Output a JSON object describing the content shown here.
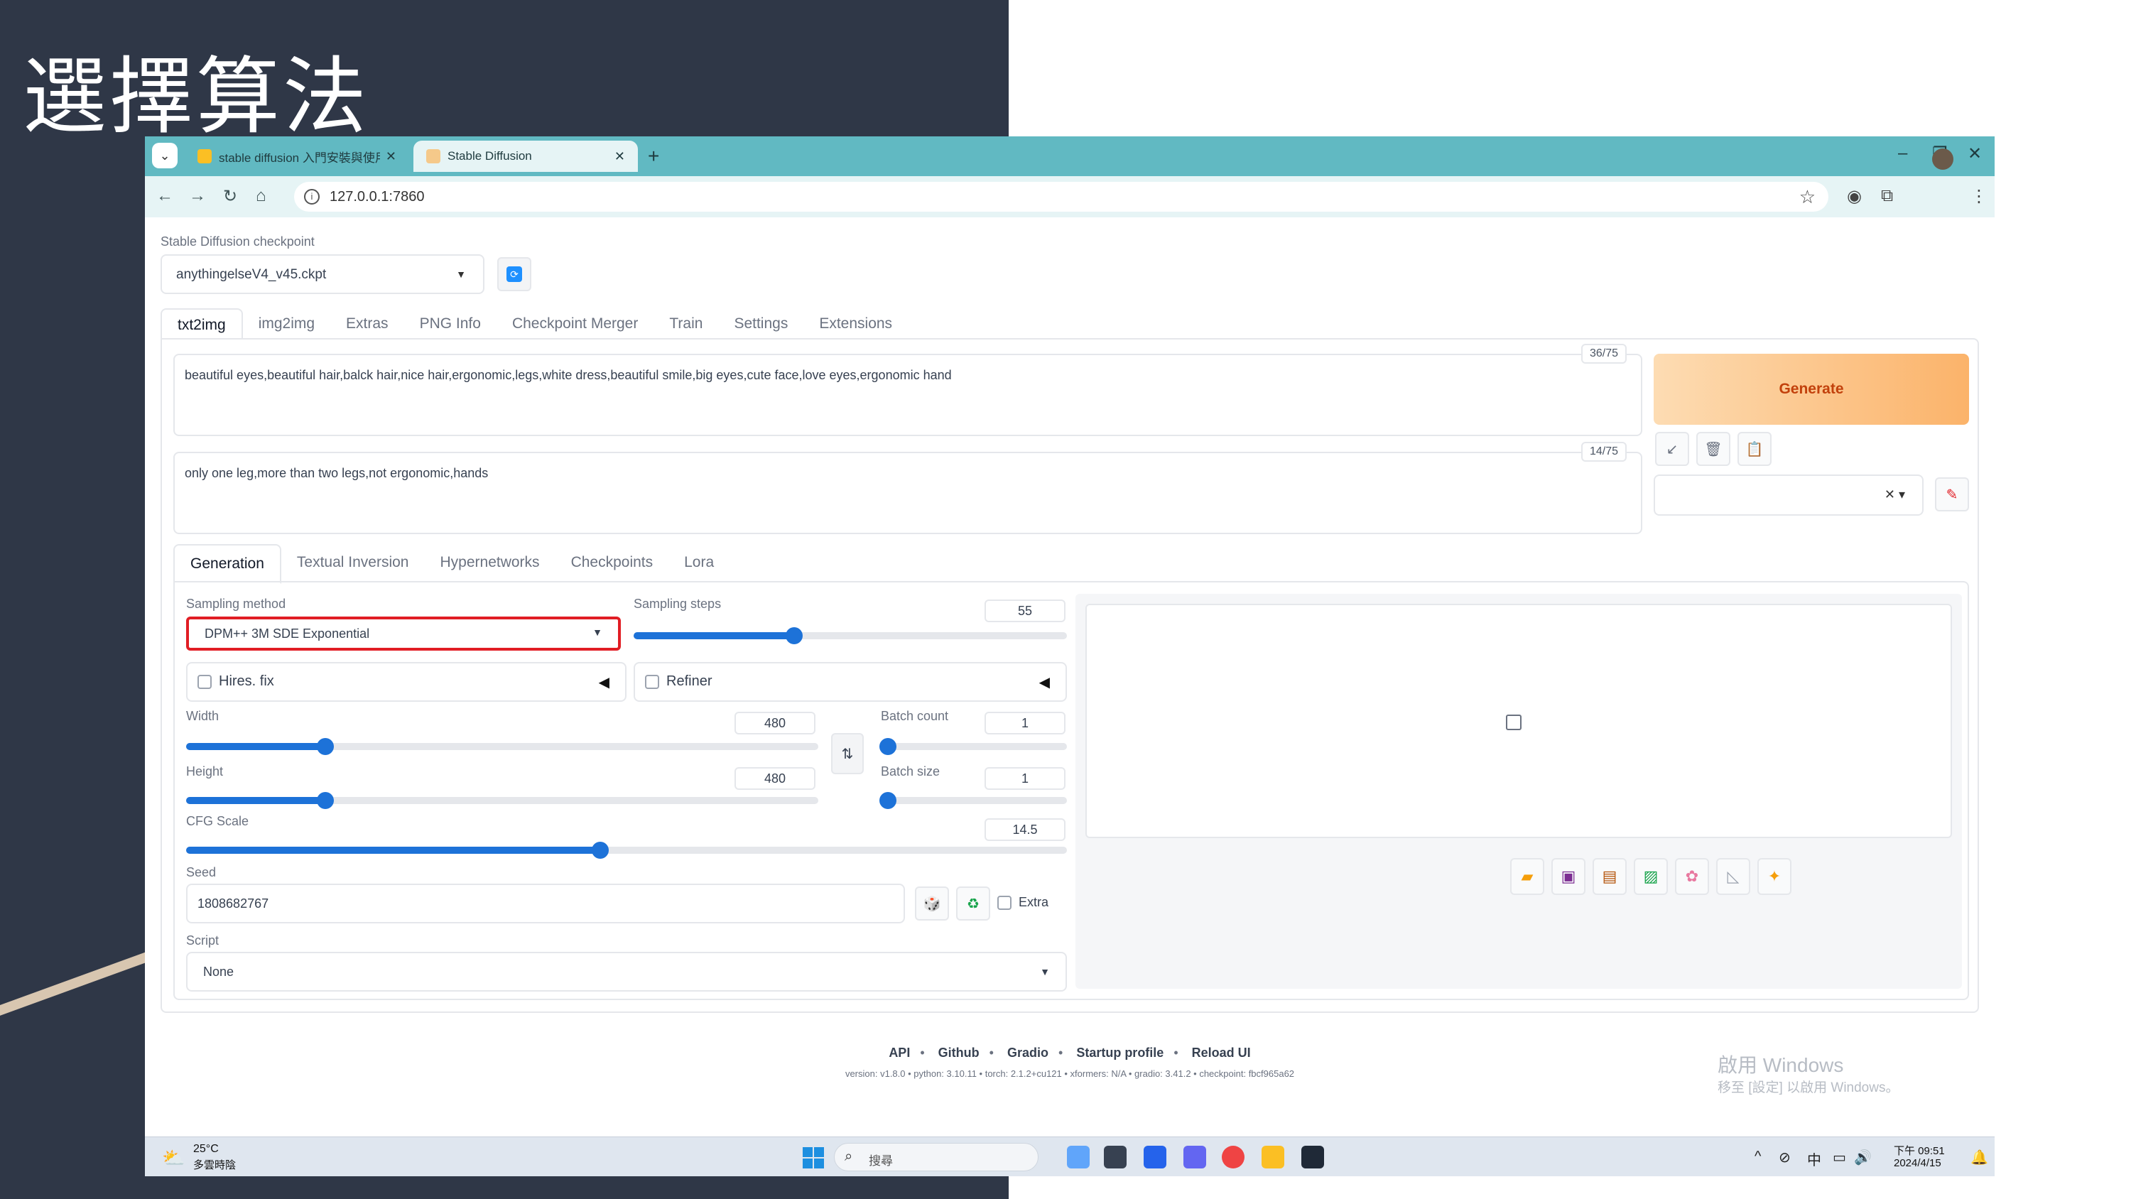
{
  "slide": {
    "title": "選擇算法"
  },
  "browser": {
    "tabs": [
      {
        "title": "stable diffusion 入門安裝與使用"
      },
      {
        "title": "Stable Diffusion"
      }
    ],
    "new_tab": "+",
    "url": "127.0.0.1:7860"
  },
  "checkpoint": {
    "label": "Stable Diffusion checkpoint",
    "value": "anythingelseV4_v45.ckpt"
  },
  "main_tabs": [
    "txt2img",
    "img2img",
    "Extras",
    "PNG Info",
    "Checkpoint Merger",
    "Train",
    "Settings",
    "Extensions"
  ],
  "prompt": {
    "text": "beautiful eyes,beautiful hair,balck hair,nice hair,ergonomic,legs,white dress,beautiful smile,big eyes,cute face,love eyes,ergonomic hand",
    "counter": "36/75"
  },
  "negative_prompt": {
    "text": "only one leg,more than two legs,not ergonomic,hands",
    "counter": "14/75"
  },
  "generate_label": "Generate",
  "sub_tabs": [
    "Generation",
    "Textual Inversion",
    "Hypernetworks",
    "Checkpoints",
    "Lora"
  ],
  "sampling": {
    "method_label": "Sampling method",
    "method_value": "DPM++ 3M SDE Exponential",
    "steps_label": "Sampling steps",
    "steps_value": "55",
    "steps_fraction": 0.37
  },
  "hires_label": "Hires. fix",
  "refiner_label": "Refiner",
  "width": {
    "label": "Width",
    "value": "480",
    "fraction": 0.22
  },
  "height": {
    "label": "Height",
    "value": "480",
    "fraction": 0.22
  },
  "batch_count": {
    "label": "Batch count",
    "value": "1",
    "fraction": 0.0
  },
  "batch_size": {
    "label": "Batch size",
    "value": "1",
    "fraction": 0.0
  },
  "cfg": {
    "label": "CFG Scale",
    "value": "14.5",
    "fraction": 0.47
  },
  "seed": {
    "label": "Seed",
    "value": "1808682767",
    "extra_label": "Extra"
  },
  "script": {
    "label": "Script",
    "value": "None"
  },
  "footer": {
    "links": [
      "API",
      "Github",
      "Gradio",
      "Startup profile",
      "Reload UI"
    ],
    "version_line": "version: v1.8.0  •  python: 3.10.11  •  torch: 2.1.2+cu121  •  xformers: N/A  •  gradio: 3.41.2  •  checkpoint: fbcf965a62"
  },
  "watermark": {
    "line1": "啟用 Windows",
    "line2": "移至 [設定] 以啟用 Windows。"
  },
  "taskbar": {
    "temp": "25°C",
    "weather": "多雲時陰",
    "search_placeholder": "搜尋",
    "ime": "中",
    "time": "下午 09:51",
    "date": "2024/4/15"
  },
  "colors": {
    "accent": "#1d72d8",
    "generate": "#fbb36a",
    "highlight": "#e11d24",
    "tabbar": "#61b9c2",
    "slide_bg": "#2f3747"
  }
}
